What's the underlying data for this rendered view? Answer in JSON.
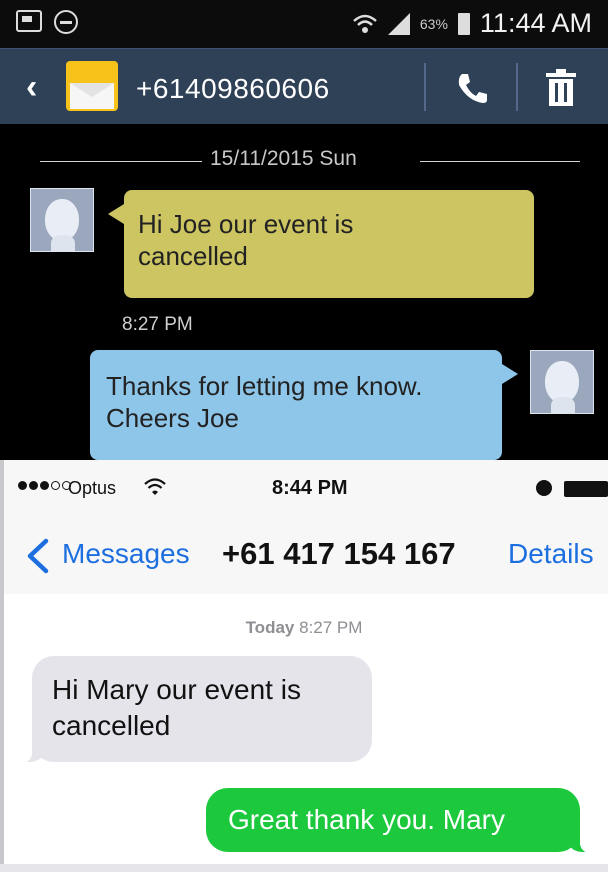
{
  "android": {
    "status": {
      "battery_pct": "63%",
      "time": "11:44 AM"
    },
    "header": {
      "phone_number": "+61409860606",
      "back_icon": "chevron-left-icon",
      "contact_icon": "envelope-icon",
      "call_icon": "phone-icon",
      "delete_icon": "trash-icon"
    },
    "conversation": {
      "date": "15/11/2015 Sun",
      "messages": [
        {
          "direction": "incoming",
          "text_line1": "Hi Joe our event is",
          "text_line2": "cancelled",
          "time": "8:27 PM",
          "color": "#ccc562"
        },
        {
          "direction": "outgoing",
          "text_line1": "Thanks for letting me know.",
          "text_line2": "Cheers Joe",
          "color": "#8ec6ea"
        }
      ]
    }
  },
  "ios": {
    "status": {
      "carrier": "Optus",
      "time": "8:44 PM"
    },
    "nav": {
      "back_label": "Messages",
      "title": "+61 417 154 167",
      "details_label": "Details",
      "accent": "#1d6fe0"
    },
    "conversation": {
      "timestamp_day": "Today",
      "timestamp_time": "8:27 PM",
      "messages": [
        {
          "direction": "incoming",
          "text_line1": "Hi Mary our event is",
          "text_line2": "cancelled",
          "color": "#e4e4ea"
        },
        {
          "direction": "outgoing",
          "text": "Great thank you. Mary",
          "color": "#1cc83c"
        }
      ]
    }
  }
}
